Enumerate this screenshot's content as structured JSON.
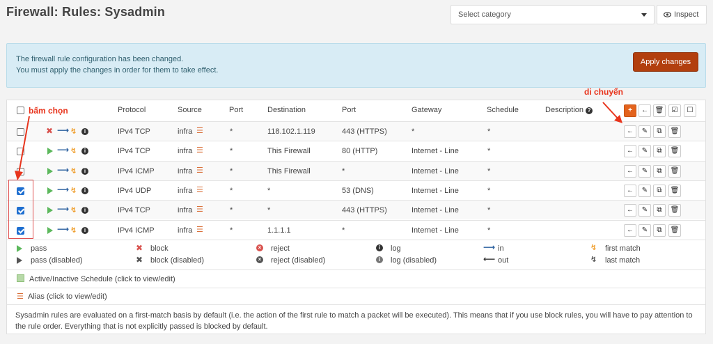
{
  "page": {
    "title": "Firewall: Rules: Sysadmin"
  },
  "category_select": {
    "placeholder": "Select category"
  },
  "inspect_button": {
    "label": "Inspect"
  },
  "alert": {
    "line1": "The firewall rule configuration has been changed.",
    "line2": "You must apply the changes in order for them to take effect.",
    "apply_label": "Apply changes"
  },
  "table": {
    "headers": {
      "protocol": "Protocol",
      "source": "Source",
      "port": "Port",
      "destination": "Destination",
      "dest_port": "Port",
      "gateway": "Gateway",
      "schedule": "Schedule",
      "description": "Description"
    },
    "header_action_icons": [
      "plus-icon",
      "arrow-left-icon",
      "trash-icon",
      "check-square-icon",
      "square-icon"
    ],
    "rows": [
      {
        "checked": false,
        "action": "block",
        "protocol": "IPv4 TCP",
        "source": "infra",
        "port": "*",
        "destination": "118.102.1.119",
        "dest_port": "443 (HTTPS)",
        "gateway": "*",
        "schedule": "*"
      },
      {
        "checked": false,
        "action": "pass",
        "protocol": "IPv4 TCP",
        "source": "infra",
        "port": "*",
        "destination": "This Firewall",
        "dest_port": "80 (HTTP)",
        "gateway": "Internet - Line",
        "schedule": "*"
      },
      {
        "checked": false,
        "action": "pass",
        "protocol": "IPv4 ICMP",
        "source": "infra",
        "port": "*",
        "destination": "This Firewall",
        "dest_port": "*",
        "gateway": "Internet - Line",
        "schedule": "*"
      },
      {
        "checked": true,
        "action": "pass",
        "protocol": "IPv4 UDP",
        "source": "infra",
        "port": "*",
        "destination": "*",
        "dest_port": "53 (DNS)",
        "gateway": "Internet - Line",
        "schedule": "*"
      },
      {
        "checked": true,
        "action": "pass",
        "protocol": "IPv4 TCP",
        "source": "infra",
        "port": "*",
        "destination": "*",
        "dest_port": "443 (HTTPS)",
        "gateway": "Internet - Line",
        "schedule": "*"
      },
      {
        "checked": true,
        "action": "pass",
        "protocol": "IPv4 ICMP",
        "source": "infra",
        "port": "*",
        "destination": "1.1.1.1",
        "dest_port": "*",
        "gateway": "Internet - Line",
        "schedule": "*"
      }
    ]
  },
  "legend": {
    "pass": "pass",
    "pass_disabled": "pass (disabled)",
    "block": "block",
    "block_disabled": "block (disabled)",
    "reject": "reject",
    "reject_disabled": "reject (disabled)",
    "log": "log",
    "log_disabled": "log (disabled)",
    "in": "in",
    "out": "out",
    "first_match": "first match",
    "last_match": "last match"
  },
  "footer": {
    "schedule_note": "Active/Inactive Schedule (click to view/edit)",
    "alias_note": "Alias (click to view/edit)",
    "description_line1": "Sysadmin rules are evaluated on a first-match basis by default (i.e. the action of the first rule to match a packet will be executed). This means that if you use block rules, you will have to pay attention to",
    "description_line2": "the rule order. Everything that is not explicitly passed is blocked by default."
  },
  "annotations": {
    "select_label": "bấm chọn",
    "move_label": "di chuyển"
  },
  "colors": {
    "accent_orange": "#e3631d",
    "apply_brown": "#b23f0e",
    "alert_bg": "#d8ecf5",
    "annotation_red": "#e8341c"
  }
}
